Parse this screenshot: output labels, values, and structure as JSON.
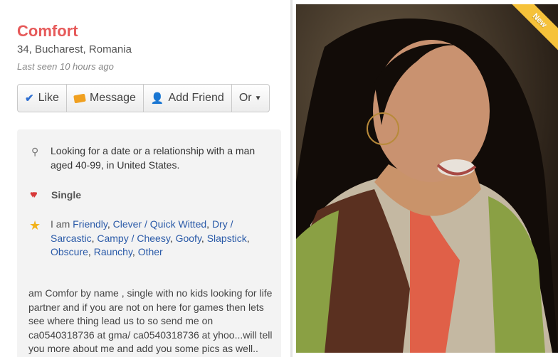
{
  "profile": {
    "name": "Comfort",
    "location": "34, Bucharest, Romania",
    "last_seen": "Last seen 10 hours ago"
  },
  "actions": {
    "like": "Like",
    "message": "Message",
    "add_friend": "Add Friend",
    "more": "Or"
  },
  "details": {
    "looking_for": "Looking for a date or a relationship with a man aged 40-99, in United States.",
    "status": "Single",
    "i_am_label": "I am",
    "traits": [
      "Friendly",
      "Clever / Quick Witted",
      "Dry / Sarcastic",
      "Campy / Cheesy",
      "Goofy",
      "Slapstick",
      "Obscure",
      "Raunchy",
      "Other"
    ]
  },
  "about": "am Comfor by name , single with no kids looking for life partner and if you are not on here for games then lets see where thing lead us to so send me on ca0540318736 at gma/ ca0540318736 at yhoo...will tell you more about me and add you some pics as well..",
  "photo": {
    "badge": "New"
  },
  "colors": {
    "name": "#e65a5a",
    "link": "#2a5aa8",
    "badge": "#f6c23a"
  }
}
